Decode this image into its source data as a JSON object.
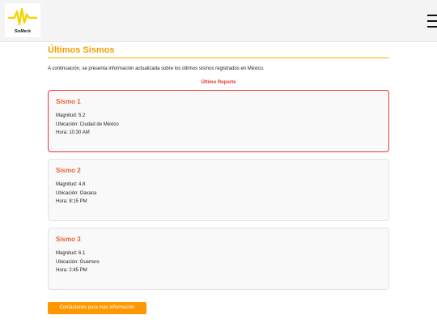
{
  "header": {
    "logo_text": "SisMeck",
    "logo_icon": "seismograph-wave-logo",
    "menu_icon": "hamburger-menu-icon"
  },
  "main": {
    "title": "Últimos Sismos",
    "intro": "A continuación, se presenta información actualizada sobre los últimos sismos registrados en México.",
    "report_label": "Último Reporte",
    "quakes": [
      {
        "title": "Sismo 1",
        "magnitude": "Magnitud: 5.2",
        "location": "Ubicación: Ciudad de México",
        "time": "Hora: 10:30 AM"
      },
      {
        "title": "Sismo 2",
        "magnitude": "Magnitud: 4.8",
        "location": "Ubicación: Oaxaca",
        "time": "Hora: 8:15 PM"
      },
      {
        "title": "Sismo 3",
        "magnitude": "Magnitud: 6.1",
        "location": "Ubicación: Guerrero",
        "time": "Hora: 2:45 PM"
      }
    ],
    "cta_label": "Contáctanos para más información"
  },
  "colors": {
    "accent": "#f2a000",
    "alert": "#e53935",
    "card_title": "#e8623b",
    "button": "#ff9800"
  }
}
